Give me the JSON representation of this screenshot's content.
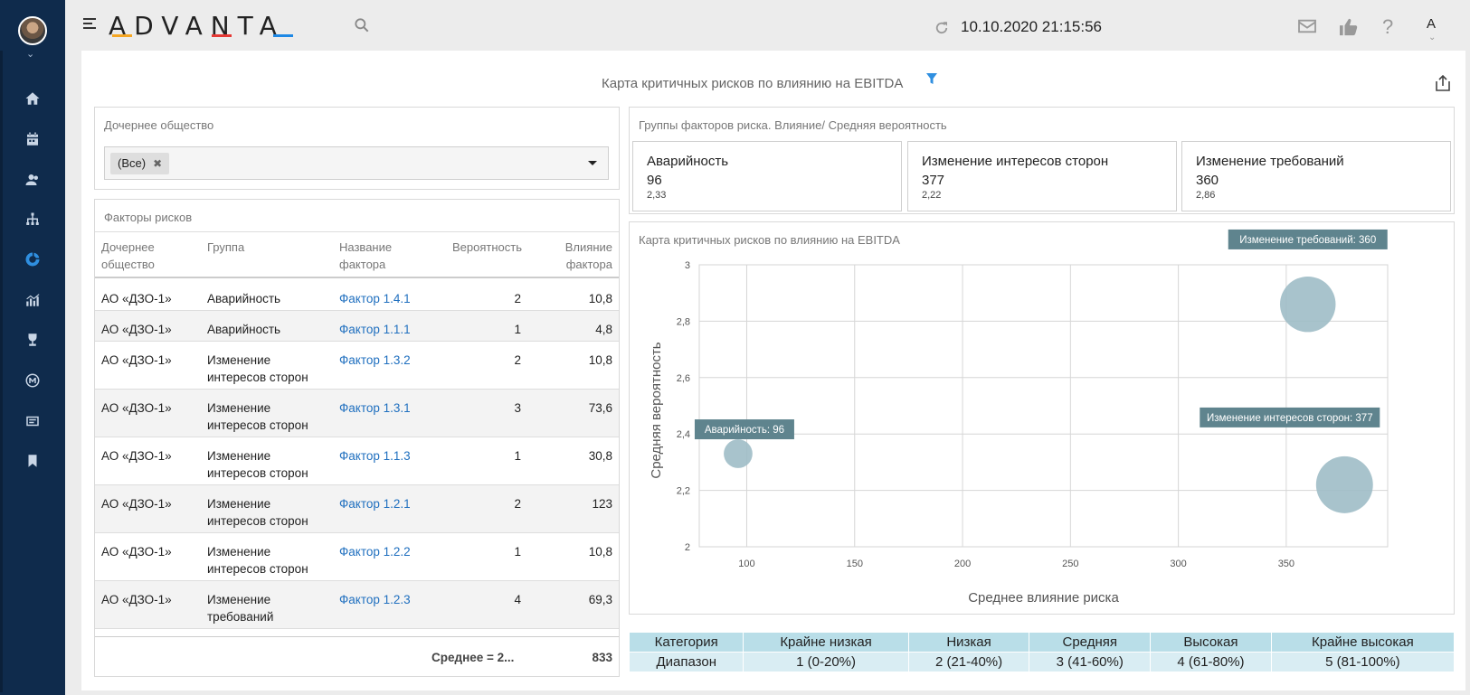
{
  "header": {
    "logo_text": "ADVANTA",
    "datetime": "10.10.2020 21:15:56",
    "user_initial": "A"
  },
  "rail": {
    "items": [
      {
        "icon": "home-icon"
      },
      {
        "icon": "calendar-icon"
      },
      {
        "icon": "users-icon"
      },
      {
        "icon": "hierarchy-icon"
      },
      {
        "icon": "donut-chart-icon",
        "active": true
      },
      {
        "icon": "bar-chart-icon"
      },
      {
        "icon": "trophy-icon"
      },
      {
        "icon": "m-circle-icon"
      },
      {
        "icon": "news-icon"
      },
      {
        "icon": "bookmark-icon"
      }
    ]
  },
  "page": {
    "title": "Карта критичных рисков по влиянию на EBITDA"
  },
  "filter": {
    "title": "Дочернее общество",
    "tag": "(Все)",
    "tag_remove": "✖"
  },
  "factors": {
    "title": "Факторы рисков",
    "columns": {
      "company": [
        "Дочернее",
        "общество"
      ],
      "group": "Группа",
      "name": [
        "Название",
        "фактора"
      ],
      "prob": "Вероятность",
      "impact": [
        "Влияние",
        "фактора"
      ]
    },
    "rows": [
      {
        "company": "АО «ДЗО-1»",
        "group": [
          "Аварийность"
        ],
        "factor": "Фактор 1.4.1",
        "prob": "2",
        "impact": "10,8"
      },
      {
        "company": "АО «ДЗО-1»",
        "group": [
          "Аварийность"
        ],
        "factor": "Фактор 1.1.1",
        "prob": "1",
        "impact": "4,8"
      },
      {
        "company": "АО «ДЗО-1»",
        "group": [
          "Изменение",
          "интересов сторон"
        ],
        "factor": "Фактор 1.3.2",
        "prob": "2",
        "impact": "10,8"
      },
      {
        "company": "АО «ДЗО-1»",
        "group": [
          "Изменение",
          "интересов сторон"
        ],
        "factor": "Фактор 1.3.1",
        "prob": "3",
        "impact": "73,6"
      },
      {
        "company": "АО «ДЗО-1»",
        "group": [
          "Изменение",
          "интересов сторон"
        ],
        "factor": "Фактор 1.1.3",
        "prob": "1",
        "impact": "30,8"
      },
      {
        "company": "АО «ДЗО-1»",
        "group": [
          "Изменение",
          "интересов сторон"
        ],
        "factor": "Фактор 1.2.1",
        "prob": "2",
        "impact": "123"
      },
      {
        "company": "АО «ДЗО-1»",
        "group": [
          "Изменение",
          "интересов сторон"
        ],
        "factor": "Фактор 1.2.2",
        "prob": "1",
        "impact": "10,8"
      },
      {
        "company": "АО «ДЗО-1»",
        "group": [
          "Изменение",
          "требований"
        ],
        "factor": "Фактор 1.2.3",
        "prob": "4",
        "impact": "69,3"
      }
    ],
    "footer": {
      "avg_label": "Среднее = 2...",
      "total": "833"
    }
  },
  "groups": {
    "title": "Группы факторов риска. Влияние/ Средняя вероятность",
    "cards": [
      {
        "name": "Аварийность",
        "impact": "96",
        "prob": "2,33"
      },
      {
        "name": "Изменение интересов сторон",
        "impact": "377",
        "prob": "2,22"
      },
      {
        "name": "Изменение требований",
        "impact": "360",
        "prob": "2,86"
      }
    ]
  },
  "bubble": {
    "title": "Карта критичных рисков по влиянию на EBITDA"
  },
  "chart_data": {
    "type": "scatter",
    "title": "Карта критичных рисков по влиянию на EBITDA",
    "xlabel": "Среднее влияние риска",
    "ylabel": "Средняя вероятность",
    "xlim": [
      78,
      397
    ],
    "ylim": [
      2,
      3
    ],
    "xticks": [
      100,
      150,
      200,
      250,
      300,
      350
    ],
    "xtick_labels": [
      "100",
      "150",
      "200",
      "250",
      "300",
      "350"
    ],
    "yticks": [
      2,
      2.2,
      2.4,
      2.6,
      2.8,
      3
    ],
    "ytick_labels": [
      "2",
      "2,2",
      "2,4",
      "2,6",
      "2,8",
      "3"
    ],
    "grid": true,
    "points": [
      {
        "label": "Аварийность: 96",
        "x": 96,
        "y": 2.33,
        "size": 96
      },
      {
        "label": "Изменение требований: 360",
        "x": 360,
        "y": 2.86,
        "size": 360
      },
      {
        "label": "Изменение интересов сторон: 377",
        "x": 377,
        "y": 2.22,
        "size": 377
      }
    ],
    "color": "#9fbcc6",
    "label_bg": "#5f848e"
  },
  "legend_table": {
    "header": [
      "Категория",
      "Крайне низкая",
      "Низкая",
      "Средняя",
      "Высокая",
      "Крайне высокая"
    ],
    "row": [
      "Диапазон",
      "1 (0-20%)",
      "2 (21-40%)",
      "3 (41-60%)",
      "4 (61-80%)",
      "5 (81-100%)"
    ]
  }
}
